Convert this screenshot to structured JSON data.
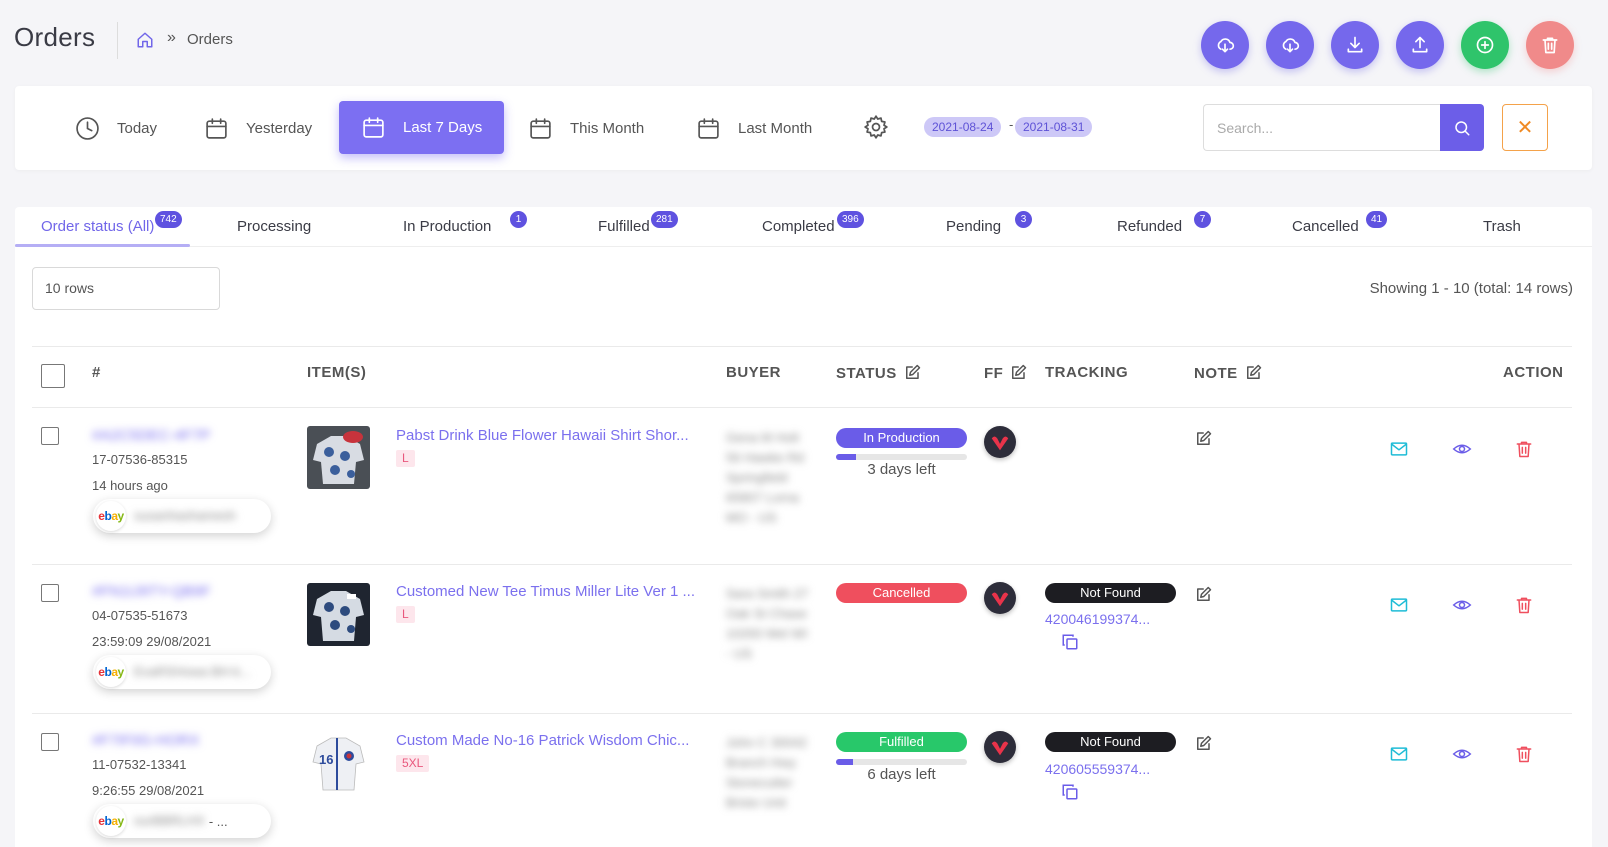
{
  "header": {
    "title": "Orders",
    "breadcrumb_sep": "»",
    "breadcrumb_current": "Orders",
    "buttons": [
      {
        "name": "cloud-download-button",
        "color": "#7568ec"
      },
      {
        "name": "cloud-sync-button",
        "color": "#7568ec"
      },
      {
        "name": "download-button",
        "color": "#7568ec"
      },
      {
        "name": "upload-button",
        "color": "#7568ec"
      },
      {
        "name": "add-order-button",
        "color": "#2fc46b"
      },
      {
        "name": "delete-button",
        "color": "#f08a8a"
      }
    ]
  },
  "filters": {
    "today": "Today",
    "yesterday": "Yesterday",
    "last7": "Last 7 Days",
    "this_month": "This Month",
    "last_month": "Last Month",
    "date_from": "2021-08-24",
    "date_sep": "-",
    "date_to": "2021-08-31",
    "search_placeholder": "Search...",
    "clear": "✕"
  },
  "tabs": [
    {
      "label": "Order status (All)",
      "count": "742"
    },
    {
      "label": "Processing",
      "count": ""
    },
    {
      "label": "In Production",
      "count": "1"
    },
    {
      "label": "Fulfilled",
      "count": "281"
    },
    {
      "label": "Completed",
      "count": "396"
    },
    {
      "label": "Pending",
      "count": "3"
    },
    {
      "label": "Refunded",
      "count": "7"
    },
    {
      "label": "Cancelled",
      "count": "41"
    },
    {
      "label": "Trash",
      "count": ""
    }
  ],
  "table": {
    "rows_select": "10 rows",
    "showing": "Showing 1 - 10 (total: 14 rows)",
    "headers": {
      "number": "#",
      "items": "ITEM(S)",
      "buyer": "BUYER",
      "status": "STATUS",
      "ff": "FF",
      "tracking": "TRACKING",
      "note": "NOTE",
      "action": "ACTION"
    },
    "rows": [
      {
        "order_id": "#A2C5DEC-4F7P",
        "code": "17-07536-85315",
        "time": "14 hours ago",
        "store": "susanhashamesh",
        "item_name": "Pabst Drink Blue Flower Hawaii Shirt Shor...",
        "size": "L",
        "buyer": "Gena M Holt 56 Hawke Rd Springfield 65807 Lorna MO - US",
        "status": "In Production",
        "status_color": "#6a5ce8",
        "progress": 0.15,
        "days_left": "3 days left",
        "tracking_status": "",
        "tracking_number": ""
      },
      {
        "order_id": "#FN1IJ9TY-QB9F",
        "code": "04-07535-51673",
        "time": "23:59:09 29/08/2021",
        "store": "EvaRSHowa BH-k...",
        "item_name": "Customed New Tee Timus Miller Lite Ver 1 ...",
        "size": "L",
        "buyer": "Sara Smith 27 Oak St Chase 10293 Wel WI - US",
        "status": "Cancelled",
        "status_color": "#ef4f5e",
        "progress": null,
        "days_left": "",
        "tracking_status": "Not Found",
        "tracking_number": "420046199374..."
      },
      {
        "order_id": "#F7IF0G-HORX",
        "code": "11-07532-13341",
        "time": "9:26:55 29/08/2021",
        "store": "ourBBRLHX",
        "store_suffix": "- ...",
        "item_name": "Custom Made No-16 Patrick Wisdom Chic...",
        "size": "5XL",
        "buyer": "John C 30042 Branch Hwy Stonecutter Bristo Unit",
        "status": "Fulfilled",
        "status_color": "#28c86a",
        "progress": 0.13,
        "days_left": "6 days left",
        "tracking_status": "Not Found",
        "tracking_number": "420605559374..."
      }
    ]
  }
}
